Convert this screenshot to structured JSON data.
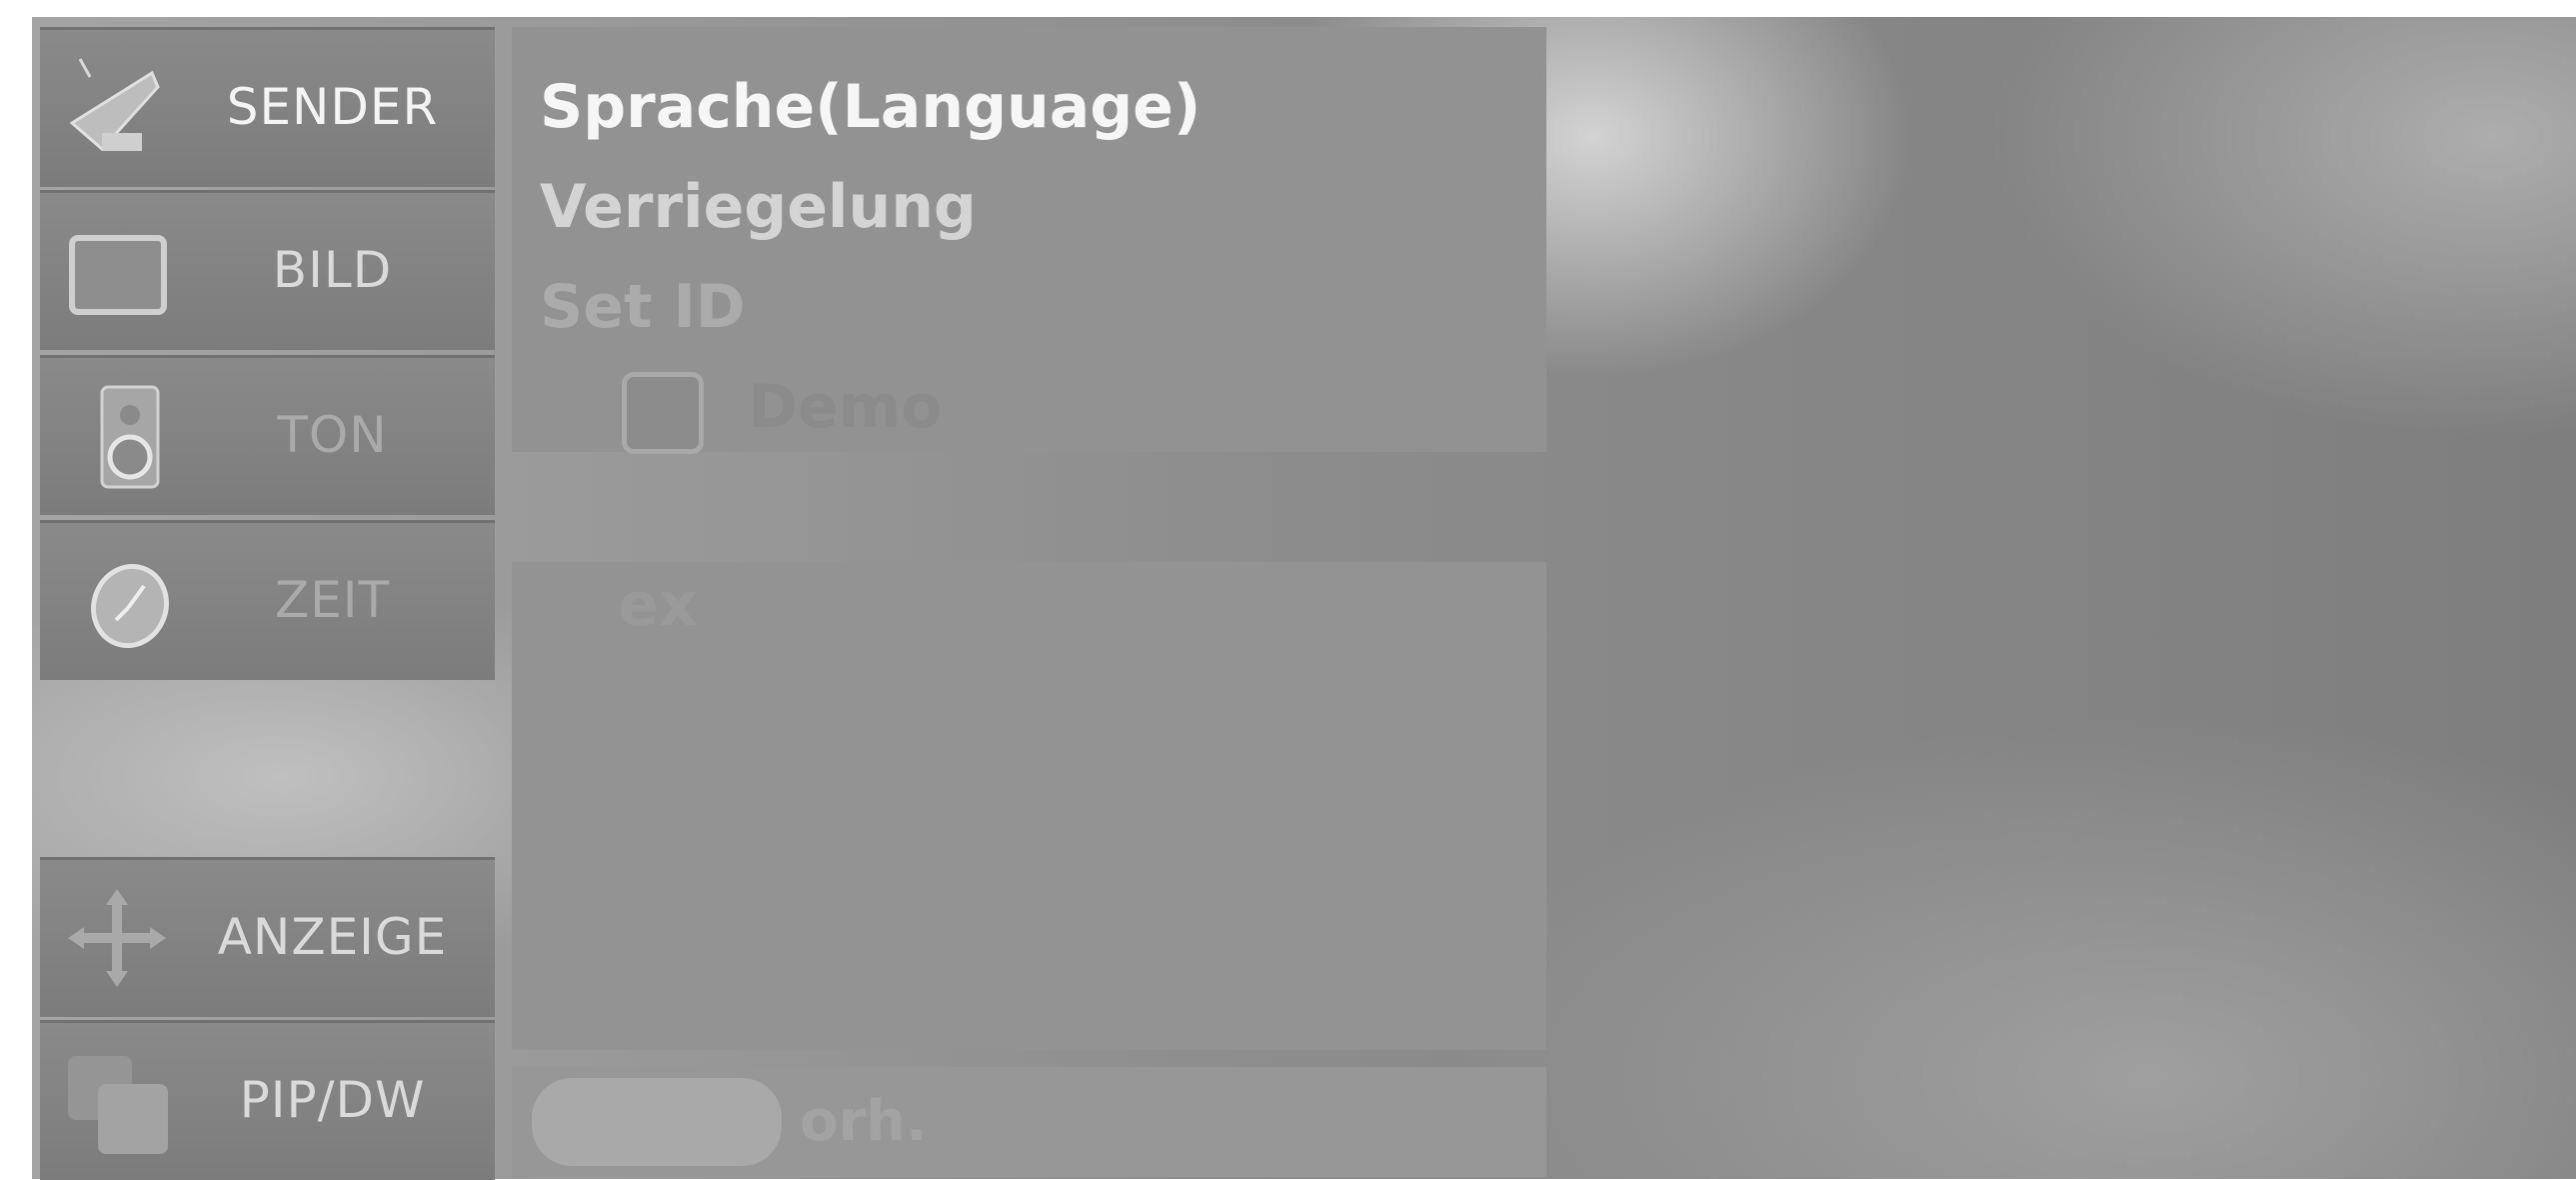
{
  "menu": {
    "items": [
      {
        "label": "SENDER",
        "icon": "satellite-dish-icon"
      },
      {
        "label": "BILD",
        "icon": "screen-icon"
      },
      {
        "label": "TON",
        "icon": "speaker-icon"
      },
      {
        "label": "ZEIT",
        "icon": "clock-icon"
      },
      {
        "label": "ANZEIGE",
        "icon": "move-arrows-icon"
      },
      {
        "label": "PIP/DW",
        "icon": "pip-windows-icon"
      }
    ]
  },
  "submenu": {
    "items": [
      {
        "label": "Sprache(Language)"
      },
      {
        "label": "Verriegelung"
      },
      {
        "label": "Set ID"
      },
      {
        "label": "Demo",
        "icon": "checkbox-icon"
      }
    ],
    "partial_label": "ex"
  },
  "footer": {
    "close_label": "orh."
  },
  "colors": {
    "background": "#8c8c8c",
    "menu_item": "#848484",
    "panel": "#939393",
    "text_bright": "#f4f4f4"
  }
}
